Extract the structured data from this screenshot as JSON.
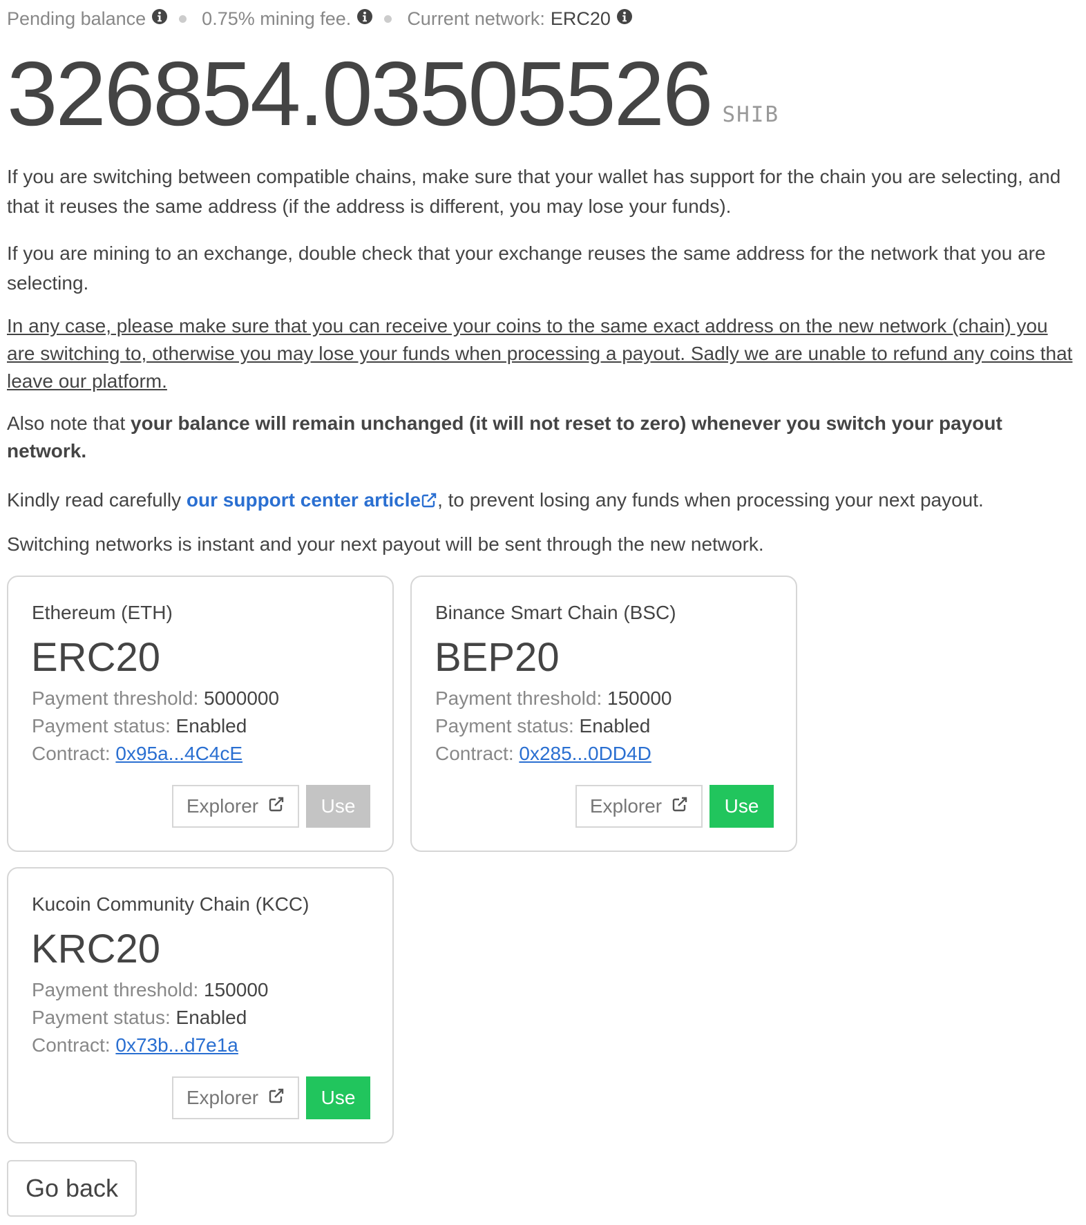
{
  "header": {
    "pending_label": "Pending balance",
    "fee_label": "0.75% mining fee.",
    "network_label": "Current network:",
    "network_value": "ERC20"
  },
  "balance": {
    "amount": "326854.03505526",
    "unit": "SHIB"
  },
  "notes": {
    "p1": "If you are switching between compatible chains, make sure that your wallet has support for the chain you are selecting, and that it reuses the same address (if the address is different, you may lose your funds).",
    "p2": "If you are mining to an exchange, double check that your exchange reuses the same address for the network that you are selecting.",
    "p3": "In any case, please make sure that you can receive your coins to the same exact address on the new network (chain) you are switching to, otherwise you may lose your funds when processing a payout. Sadly we are unable to refund any coins that leave our platform.",
    "p4_prefix": "Also note that ",
    "p4_bold": "your balance will remain unchanged (it will not reset to zero) whenever you switch your payout network.",
    "p5_prefix": "Kindly read carefully ",
    "p5_link": "our support center article",
    "p5_suffix": ", to prevent losing any funds when processing your next payout.",
    "p6": "Switching networks is instant and your next payout will be sent through the new network."
  },
  "labels": {
    "threshold": "Payment threshold:",
    "status": "Payment status:",
    "contract": "Contract:",
    "explorer": "Explorer",
    "use": "Use"
  },
  "networks": [
    {
      "chain": "Ethereum (ETH)",
      "token": "ERC20",
      "threshold": "5000000",
      "status": "Enabled",
      "contract": "0x95a...4C4cE",
      "use_enabled": false
    },
    {
      "chain": "Binance Smart Chain (BSC)",
      "token": "BEP20",
      "threshold": "150000",
      "status": "Enabled",
      "contract": "0x285...0DD4D",
      "use_enabled": true
    },
    {
      "chain": "Kucoin Community Chain (KCC)",
      "token": "KRC20",
      "threshold": "150000",
      "status": "Enabled",
      "contract": "0x73b...d7e1a",
      "use_enabled": true
    }
  ],
  "footer": {
    "go_back": "Go back"
  },
  "colors": {
    "accent_link": "#2a6fd1",
    "use_enabled": "#21c55d",
    "use_disabled": "#c4c4c4",
    "text_primary": "#444444",
    "text_muted": "#888888"
  },
  "icons": {
    "info": "info-circle-icon",
    "external": "external-link-icon"
  }
}
